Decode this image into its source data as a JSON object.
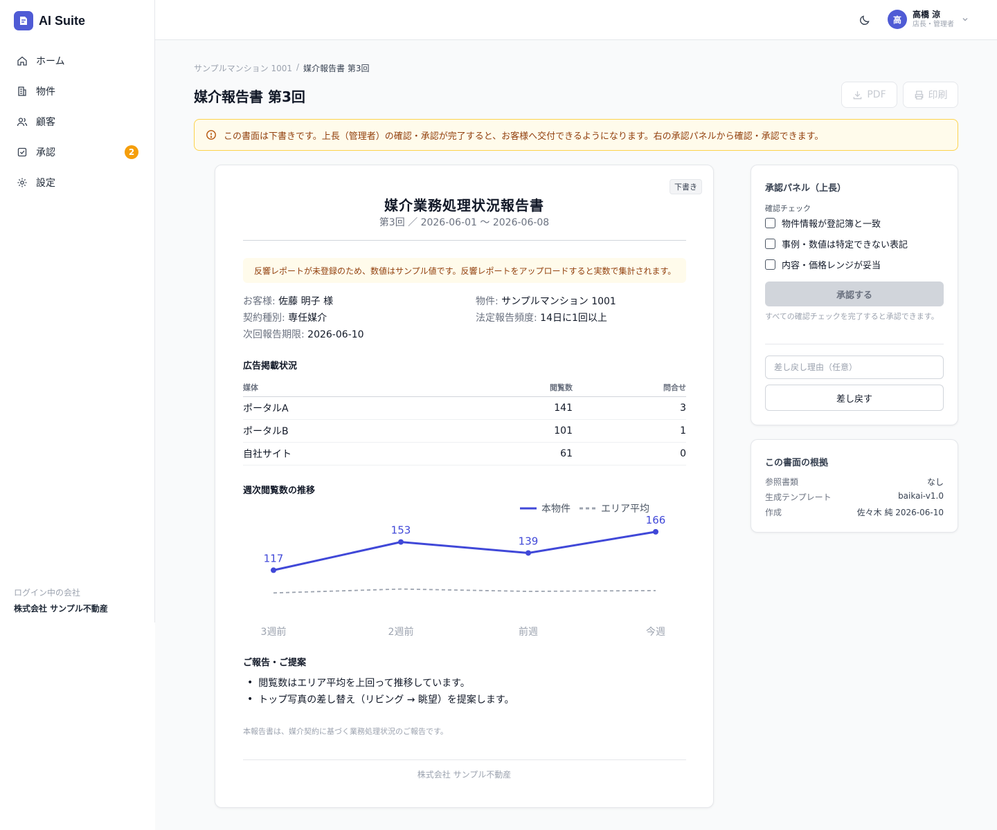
{
  "app": {
    "name": "AI Suite"
  },
  "sidebar": {
    "items": [
      {
        "label": "ホーム",
        "icon": "home-icon"
      },
      {
        "label": "物件",
        "icon": "building-icon"
      },
      {
        "label": "顧客",
        "icon": "users-icon"
      },
      {
        "label": "承認",
        "icon": "checkbox-icon",
        "badge": "2"
      },
      {
        "label": "設定",
        "icon": "gear-icon"
      }
    ],
    "company_label": "ログイン中の会社",
    "company_name": "株式会社 サンプル不動産"
  },
  "header": {
    "user": {
      "avatar": "高",
      "name": "高橋 涼",
      "role": "店長・管理者"
    }
  },
  "page": {
    "breadcrumb": [
      "サンプルマンション 1001",
      "媒介報告書 第3回"
    ],
    "breadcrumb_sep": "/",
    "title": "媒介報告書 第3回",
    "pdf_label": "PDF",
    "print_label": "印刷",
    "alert": "この書面は下書きです。上長（管理者）の確認・承認が完了すると、お客様へ交付できるようになります。右の承認パネルから確認・承認できます。"
  },
  "document": {
    "badge": "下書き",
    "title": "媒介業務処理状況報告書",
    "period": "第3回 ／ 2026-06-01 〜 2026-06-08",
    "notice": "反響レポートが未登録のため、数値はサンプル値です。反響レポートをアップロードすると実数で集計されます。",
    "customer_key": "お客様: ",
    "customer_val": "佐藤 明子 様",
    "property_key": "物件: ",
    "property_val": "サンプルマンション 1001",
    "contract_key": "契約種別: ",
    "contract_val": "専任媒介",
    "frequency_key": "法定報告頻度: ",
    "frequency_val": "14日に1回以上",
    "deadline_key": "次回報告期限: ",
    "deadline_val": "2026-06-10",
    "ads_heading": "広告掲載状況",
    "ads_columns": [
      "媒体",
      "閲覧数",
      "問合せ"
    ],
    "ads_rows": [
      [
        "ポータルA",
        "141",
        "3"
      ],
      [
        "ポータルB",
        "101",
        "1"
      ],
      [
        "自社サイト",
        "61",
        "0"
      ]
    ],
    "chart_heading": "週次閲覧数の推移",
    "proposals_heading": "ご報告・ご提案",
    "proposals": [
      "閲覧数はエリア平均を上回って推移しています。",
      "トップ写真の差し替え（リビング → 眺望）を提案します。"
    ],
    "footnote": "本報告書は、媒介契約に基づく業務処理状況のご報告です。",
    "company": "株式会社 サンプル不動産"
  },
  "chart_data": {
    "type": "line",
    "categories": [
      "3週前",
      "2週前",
      "前週",
      "今週"
    ],
    "series": [
      {
        "name": "本物件",
        "values": [
          117,
          153,
          139,
          166
        ],
        "color": "#4048d8",
        "style": "solid",
        "labels": true
      },
      {
        "name": "エリア平均",
        "values": [
          88,
          93,
          90,
          91
        ],
        "color": "#9ca3af",
        "style": "dashed",
        "labels": false
      }
    ],
    "ylim": [
      60,
      180
    ],
    "grid": false,
    "legend": "top-right"
  },
  "approval": {
    "title": "承認パネル（上長）",
    "check_heading": "確認チェック",
    "checks": [
      "物件情報が登記簿と一致",
      "事例・数値は特定できない表記",
      "内容・価格レンジが妥当"
    ],
    "approve_label": "承認する",
    "hint": "すべての確認チェックを完了すると承認できます。",
    "reason_placeholder": "差し戻し理由（任意）",
    "return_label": "差し戻す"
  },
  "basis": {
    "title": "この書面の根拠",
    "rows": [
      [
        "参照書類",
        "なし"
      ],
      [
        "生成テンプレート",
        "baikai-v1.0"
      ],
      [
        "作成",
        "佐々木 純 2026-06-10"
      ]
    ]
  },
  "colors": {
    "accent": "#4f5bd5",
    "badge": "#f59e0b",
    "warning_bg": "#fffbeb",
    "warning_text": "#92400e"
  }
}
